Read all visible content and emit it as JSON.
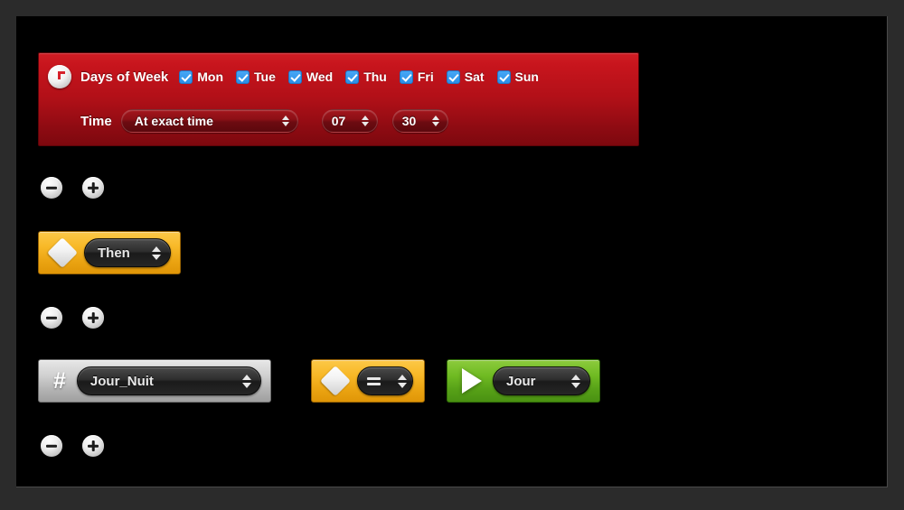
{
  "trigger": {
    "icon": "clock-icon",
    "days_label": "Days of Week",
    "days": [
      {
        "label": "Mon",
        "checked": true
      },
      {
        "label": "Tue",
        "checked": true
      },
      {
        "label": "Wed",
        "checked": true
      },
      {
        "label": "Thu",
        "checked": true
      },
      {
        "label": "Fri",
        "checked": true
      },
      {
        "label": "Sat",
        "checked": true
      },
      {
        "label": "Sun",
        "checked": true
      }
    ],
    "time_label": "Time",
    "time_mode": "At exact time",
    "hour": "07",
    "minute": "30"
  },
  "then_block": {
    "icon": "diamond-icon",
    "value": "Then"
  },
  "action_row": {
    "variable_block": {
      "icon": "hash-icon",
      "value": "Jour_Nuit"
    },
    "operator_block": {
      "icon": "diamond-icon",
      "value": "="
    },
    "value_block": {
      "icon": "play-icon",
      "value": "Jour"
    }
  },
  "controls": {
    "remove_label": "−",
    "add_label": "+"
  },
  "colors": {
    "trigger_red": "#b21018",
    "then_yellow": "#f8b928",
    "variable_grey": "#d2d2d2",
    "value_green": "#6fba22",
    "checkbox_blue": "#2b8fe8",
    "canvas_black": "#000000",
    "page_grey": "#2b2b2b"
  }
}
